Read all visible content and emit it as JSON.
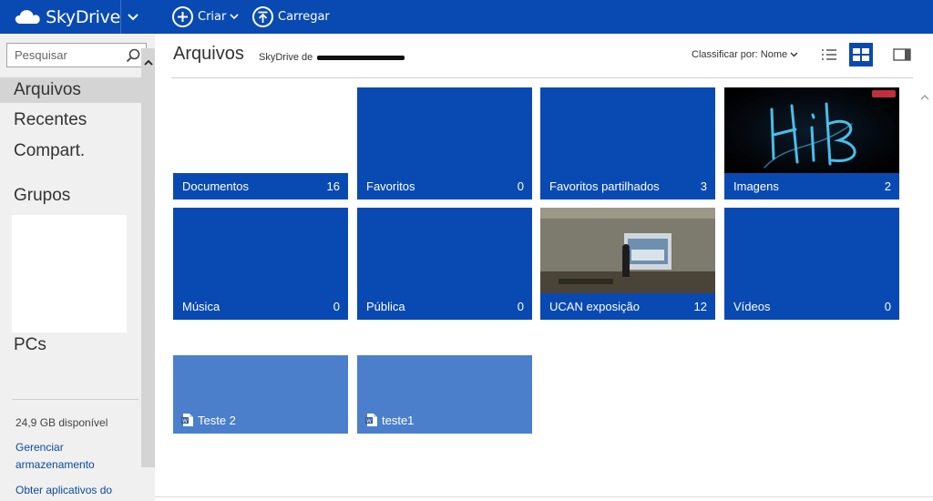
{
  "app": {
    "name": "SkyDrive"
  },
  "toolbar": {
    "create_label": "Criar",
    "upload_label": "Carregar"
  },
  "sidebar": {
    "search_placeholder": "Pesquisar",
    "nav": {
      "files": "Arquivos",
      "recent": "Recentes",
      "shared": "Compart.",
      "groups": "Grupos",
      "pcs": "PCs"
    },
    "storage": "24,9 GB disponível",
    "manage_link": "Gerenciar armazenamento",
    "apps_link": "Obter aplicativos do"
  },
  "main": {
    "title": "Arquivos",
    "owner_prefix": "SkyDrive de",
    "sort_label": "Classificar por: Nome"
  },
  "folders": [
    {
      "name": "Documentos",
      "count": "16"
    },
    {
      "name": "Favoritos",
      "count": "0"
    },
    {
      "name": "Favoritos partilhados",
      "count": "3"
    },
    {
      "name": "Imagens",
      "count": "2"
    },
    {
      "name": "Música",
      "count": "0"
    },
    {
      "name": "Pública",
      "count": "0"
    },
    {
      "name": "UCAN exposição",
      "count": "12"
    },
    {
      "name": "Vídeos",
      "count": "0"
    }
  ],
  "files": [
    {
      "name": "Teste 2"
    },
    {
      "name": "teste1"
    }
  ],
  "colors": {
    "brand": "#094ab2",
    "file_tile": "#4b7fcc",
    "sidebar_bg": "#f0f0f0"
  }
}
